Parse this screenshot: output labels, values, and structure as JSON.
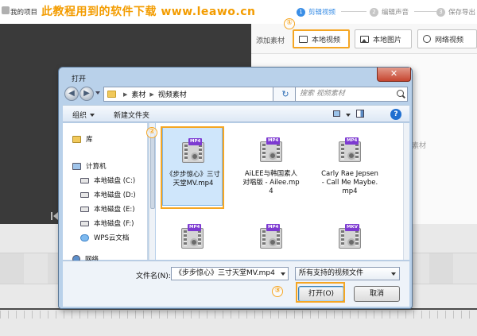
{
  "app": {
    "title": "我的项目",
    "banner": "此教程用到的软件下载 www.leawo.cn",
    "steps": [
      {
        "num": "1",
        "label": "剪辑视频",
        "active": true
      },
      {
        "num": "2",
        "label": "编辑声音",
        "active": false
      },
      {
        "num": "3",
        "label": "保存导出",
        "active": false
      }
    ],
    "add_material_label": "添加素材",
    "buttons": {
      "local_video": "本地视频",
      "local_image": "本地图片",
      "network_video": "网络视频"
    },
    "materials_hint": "素材",
    "colors": {
      "accent": "#3a8ee6",
      "banner": "#f39c00",
      "highlight": "#f5a623"
    }
  },
  "dialog": {
    "title": "打开",
    "close_glyph": "✕",
    "breadcrumb": [
      "素材",
      "视频素材"
    ],
    "refresh_glyph": "↻",
    "search_placeholder": "搜索 视频素材",
    "toolbar": {
      "organize": "组织",
      "new_folder": "新建文件夹",
      "help_glyph": "?"
    },
    "nav": [
      {
        "label": "库",
        "icon": "library-icon"
      },
      {
        "label": "计算机",
        "icon": "computer-icon"
      },
      {
        "label": "本地磁盘 (C:)",
        "icon": "drive-icon"
      },
      {
        "label": "本地磁盘 (D:)",
        "icon": "drive-icon"
      },
      {
        "label": "本地磁盘 (E:)",
        "icon": "drive-icon"
      },
      {
        "label": "本地磁盘 (F:)",
        "icon": "drive-icon"
      },
      {
        "label": "WPS云文档",
        "icon": "cloud-icon"
      },
      {
        "label": "网络",
        "icon": "network-icon"
      }
    ],
    "files": [
      {
        "name": "《步步惊心》三寸天堂MV.mp4",
        "badge": "MP4",
        "selected": true
      },
      {
        "name": "AiLEE与韩国素人对唱版 - Ailee.mp4",
        "badge": "MP4",
        "selected": false
      },
      {
        "name": "Carly Rae Jepsen - Call Me Maybe.mp4",
        "badge": "MP4",
        "selected": false
      },
      {
        "name": "",
        "badge": "MP4",
        "selected": false
      },
      {
        "name": "",
        "badge": "MP4",
        "selected": false
      },
      {
        "name": "",
        "badge": "MKV",
        "selected": false
      }
    ],
    "filename_label": "文件名(N):",
    "filename_value": "《步步惊心》三寸天堂MV.mp4",
    "filetype_value": "所有支持的视频文件",
    "open_button": "打开(O)",
    "cancel_button": "取消"
  },
  "markers": [
    "①",
    "②",
    "③"
  ]
}
